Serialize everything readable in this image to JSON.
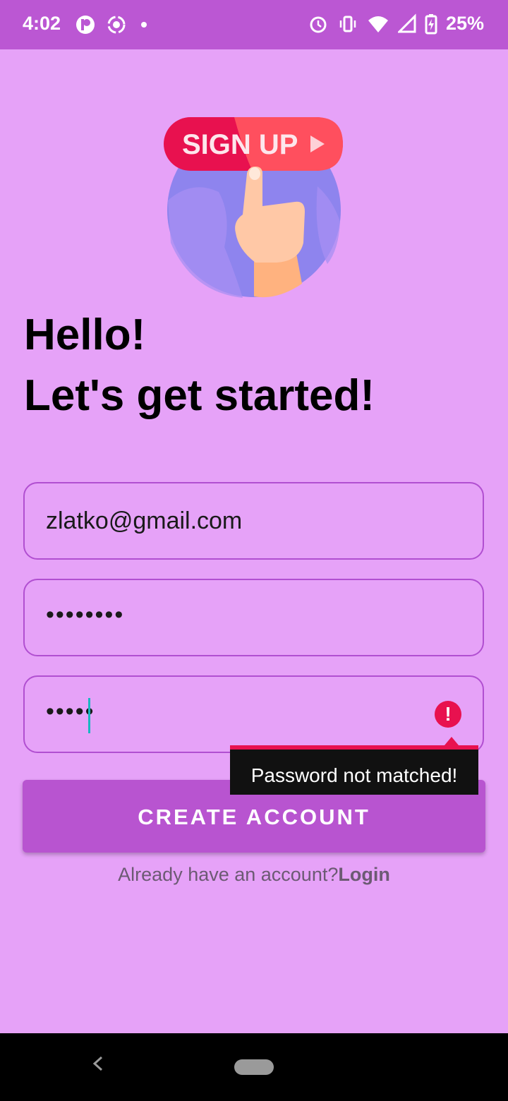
{
  "status_bar": {
    "time": "4:02",
    "battery": "25%",
    "icons": [
      "p-icon",
      "screen-record-icon",
      "dot-icon",
      "alarm-icon",
      "vibrate-icon",
      "wifi-icon",
      "signal-icon",
      "battery-charging-icon"
    ]
  },
  "hero": {
    "sign_up_text": "SIGN UP",
    "colors": {
      "pill": "#e8114f",
      "circle": "#8e84ee",
      "hand": "#ffc8a6"
    }
  },
  "greeting": {
    "line1": "Hello!",
    "line2": "Let's get started!"
  },
  "form": {
    "email_value": "zlatko@gmail.com",
    "password_value": "••••••••",
    "confirm_password_value": "•••••",
    "error_tooltip": "Password not matched!",
    "create_button_label": "CREATE ACCOUNT"
  },
  "footer": {
    "prompt": "Already have an account?",
    "login_link": "Login"
  },
  "colors": {
    "background": "#e6a2f8",
    "status_bar": "#bb57d3",
    "accent": "#b854d0",
    "error": "#e8114f"
  }
}
